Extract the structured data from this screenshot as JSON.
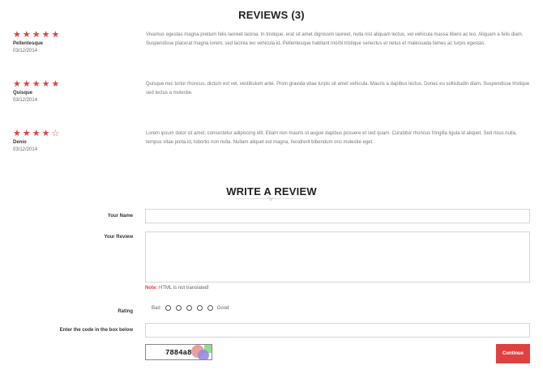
{
  "reviews_section": {
    "title": "REVIEWS (3)",
    "reviews": [
      {
        "rating": 5,
        "stars": "★★★★★",
        "author": "Pellentesque",
        "date": "03/12/2014",
        "text": "Vivamus egestas magna pretium felis laoreet lacinia. In tristique, erat sit amet dignissim laoreet, nulla nisl aliquam lectus, vel vehicula massa libero ac leo. Aliquam a felis diam. Suspendisse placerat magna lorem, sed lacinia leo vehicula id. Pellentesque habitant morbi tristique senectus et netus et malesuada fames ac turpis egestas."
      },
      {
        "rating": 5,
        "stars": "★★★★★",
        "author": "Quisque",
        "date": "03/12/2014",
        "text": "Quisque nec tortor rhoncus, dictum est vel, vestibulum ante. Proin gravida vitae turpis sit amet vehicula. Mauris a dapibus lectus. Donec eu sollicitudin diam. Suspendisse tristique sed lectus a molestie."
      },
      {
        "rating": 4,
        "stars": "★★★★☆",
        "author": "Denio",
        "date": "03/12/2014",
        "text": "Lorem ipsum dolor sit amet, consectetur adipiscing elit. Etiam non mauris ut augue dapibus posuere et sed quam. Curabitur rhoncus fringilla ligula id aliquet. Sed risus nulla, tempus vitae porta id, lobortis non nulla. Nullam aliquet est magna, hendrerit bibendum orci molestie eget."
      }
    ]
  },
  "write_review": {
    "title": "WRITE A REVIEW",
    "name_label": "Your Name",
    "name_value": "",
    "review_label": "Your Review",
    "review_value": "",
    "note_prefix": "Note:",
    "note_text": "HTML is not translated!",
    "rating_label": "Rating",
    "rating_bad": "Bad",
    "rating_good": "Good",
    "rating_options": 5,
    "captcha_label": "Enter the code in the box below",
    "captcha_value": "",
    "captcha_code": "7884a8",
    "continue_label": "Continue"
  },
  "colors": {
    "accent": "#e04040",
    "star": "#e04040",
    "border": "#d6d6d6"
  }
}
